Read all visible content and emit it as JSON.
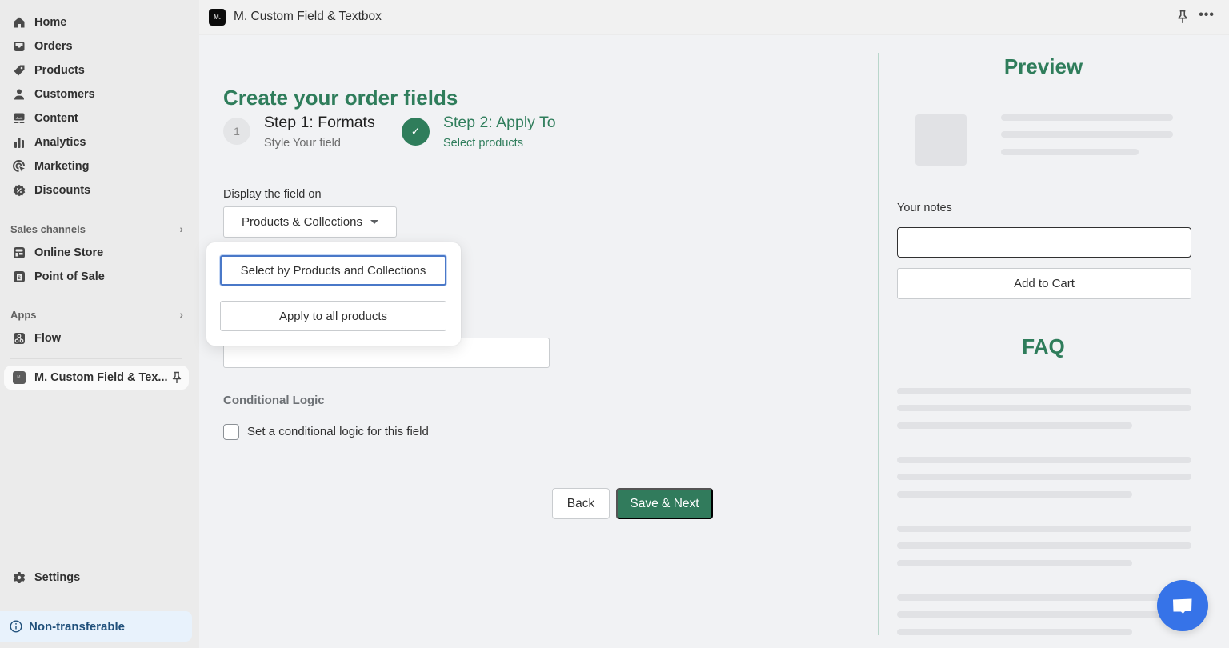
{
  "sidebar": {
    "nav": [
      {
        "label": "Home",
        "icon": "home-icon"
      },
      {
        "label": "Orders",
        "icon": "inbox-icon"
      },
      {
        "label": "Products",
        "icon": "tag-icon"
      },
      {
        "label": "Customers",
        "icon": "person-icon"
      },
      {
        "label": "Content",
        "icon": "content-icon"
      },
      {
        "label": "Analytics",
        "icon": "bar-chart-icon"
      },
      {
        "label": "Marketing",
        "icon": "target-icon"
      },
      {
        "label": "Discounts",
        "icon": "discount-icon"
      }
    ],
    "sales_channels": {
      "title": "Sales channels",
      "items": [
        {
          "label": "Online Store",
          "icon": "store-icon"
        },
        {
          "label": "Point of Sale",
          "icon": "pos-icon"
        }
      ]
    },
    "apps": {
      "title": "Apps",
      "items": [
        {
          "label": "Flow",
          "icon": "flow-icon"
        }
      ]
    },
    "active_app": {
      "label": "M. Custom Field & Tex...",
      "logo": "M."
    },
    "settings_label": "Settings",
    "non_transferable_label": "Non-transferable"
  },
  "topbar": {
    "logo": "M.",
    "title": "M. Custom Field & Textbox",
    "more": "•••"
  },
  "main": {
    "title": "Create your order fields",
    "steps": [
      {
        "number": "1",
        "title": "Step 1: Formats",
        "subtitle": "Style Your field",
        "state": "pending"
      },
      {
        "number": "✓",
        "title": "Step 2: Apply To",
        "subtitle": "Select products",
        "state": "active"
      }
    ],
    "display_field_label": "Display the field on",
    "display_select_value": "Products & Collections",
    "popover_options": [
      {
        "label": "Select by Products and Collections",
        "focused": true
      },
      {
        "label": "Apply to all products",
        "focused": false
      }
    ],
    "text_input_value": "",
    "conditional_logic_title": "Conditional Logic",
    "conditional_checkbox_label": "Set a conditional logic for this field",
    "conditional_checkbox_checked": false,
    "back_label": "Back",
    "save_next_label": "Save & Next"
  },
  "preview": {
    "title": "Preview",
    "notes_label": "Your notes",
    "notes_value": "",
    "add_to_cart_label": "Add to Cart",
    "faq_title": "FAQ"
  },
  "colors": {
    "brand_green": "#2f7d5b",
    "primary_button": "#317b5c",
    "chat_blue": "#3673e8",
    "focus_blue": "#4a78c8",
    "info_bg": "#e8f2fc"
  }
}
